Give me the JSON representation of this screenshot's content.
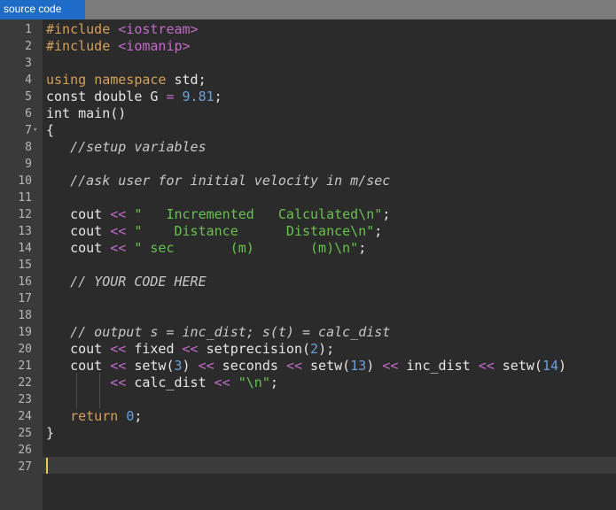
{
  "tab": {
    "label": "source code"
  },
  "colors": {
    "keyword": "#d2a05a",
    "string": "#67c24f",
    "comment": "#c8c8c8",
    "number": "#6ea0d8",
    "operator": "#c06cc8",
    "ident": "#e6e6e6"
  },
  "lines": [
    {
      "n": "1",
      "tokens": [
        [
          "#include",
          "keyword"
        ],
        [
          " ",
          "ident"
        ],
        [
          "<iostream>",
          "operator"
        ]
      ]
    },
    {
      "n": "2",
      "tokens": [
        [
          "#include",
          "keyword"
        ],
        [
          " ",
          "ident"
        ],
        [
          "<iomanip>",
          "operator"
        ]
      ]
    },
    {
      "n": "3",
      "tokens": []
    },
    {
      "n": "4",
      "tokens": [
        [
          "using",
          "keyword"
        ],
        [
          " ",
          "ident"
        ],
        [
          "namespace",
          "keyword"
        ],
        [
          " std;",
          "ident"
        ]
      ]
    },
    {
      "n": "5",
      "tokens": [
        [
          "const double G ",
          "ident"
        ],
        [
          "=",
          "operator"
        ],
        [
          " ",
          "ident"
        ],
        [
          "9.81",
          "number"
        ],
        [
          ";",
          "ident"
        ]
      ]
    },
    {
      "n": "6",
      "tokens": [
        [
          "int main()",
          "ident"
        ]
      ]
    },
    {
      "n": "7",
      "fold": "true",
      "tokens": [
        [
          "{",
          "ident"
        ]
      ]
    },
    {
      "n": "8",
      "tokens": [
        [
          "   //setup variables",
          "comment"
        ]
      ]
    },
    {
      "n": "9",
      "tokens": []
    },
    {
      "n": "10",
      "tokens": [
        [
          "   //ask user for initial velocity in m/sec",
          "comment"
        ]
      ]
    },
    {
      "n": "11",
      "tokens": []
    },
    {
      "n": "12",
      "tokens": [
        [
          "   cout ",
          "ident"
        ],
        [
          "<<",
          "operator"
        ],
        [
          " ",
          "ident"
        ],
        [
          "\"   Incremented   Calculated\\n\"",
          "string"
        ],
        [
          ";",
          "ident"
        ]
      ]
    },
    {
      "n": "13",
      "tokens": [
        [
          "   cout ",
          "ident"
        ],
        [
          "<<",
          "operator"
        ],
        [
          " ",
          "ident"
        ],
        [
          "\"    Distance      Distance\\n\"",
          "string"
        ],
        [
          ";",
          "ident"
        ]
      ]
    },
    {
      "n": "14",
      "tokens": [
        [
          "   cout ",
          "ident"
        ],
        [
          "<<",
          "operator"
        ],
        [
          " ",
          "ident"
        ],
        [
          "\" sec       (m)       (m)\\n\"",
          "string"
        ],
        [
          ";",
          "ident"
        ]
      ]
    },
    {
      "n": "15",
      "tokens": []
    },
    {
      "n": "16",
      "tokens": [
        [
          "   // YOUR CODE HERE",
          "comment"
        ]
      ]
    },
    {
      "n": "17",
      "tokens": []
    },
    {
      "n": "18",
      "tokens": []
    },
    {
      "n": "19",
      "tokens": [
        [
          "   // output s = inc_dist; s(t) = calc_dist",
          "comment"
        ]
      ]
    },
    {
      "n": "20",
      "tokens": [
        [
          "   cout ",
          "ident"
        ],
        [
          "<<",
          "operator"
        ],
        [
          " fixed ",
          "ident"
        ],
        [
          "<<",
          "operator"
        ],
        [
          " setprecision(",
          "ident"
        ],
        [
          "2",
          "number"
        ],
        [
          ");",
          "ident"
        ]
      ]
    },
    {
      "n": "21",
      "tokens": [
        [
          "   cout ",
          "ident"
        ],
        [
          "<<",
          "operator"
        ],
        [
          " setw(",
          "ident"
        ],
        [
          "3",
          "number"
        ],
        [
          ") ",
          "ident"
        ],
        [
          "<<",
          "operator"
        ],
        [
          " seconds ",
          "ident"
        ],
        [
          "<<",
          "operator"
        ],
        [
          " setw(",
          "ident"
        ],
        [
          "13",
          "number"
        ],
        [
          ") ",
          "ident"
        ],
        [
          "<<",
          "operator"
        ],
        [
          " inc_dist ",
          "ident"
        ],
        [
          "<<",
          "operator"
        ],
        [
          " setw(",
          "ident"
        ],
        [
          "14",
          "number"
        ],
        [
          ")",
          "ident"
        ]
      ]
    },
    {
      "n": "22",
      "tokens": [
        [
          "        ",
          "ident"
        ],
        [
          "<<",
          "operator"
        ],
        [
          " calc_dist ",
          "ident"
        ],
        [
          "<<",
          "operator"
        ],
        [
          " ",
          "ident"
        ],
        [
          "\"\\n\"",
          "string"
        ],
        [
          ";",
          "ident"
        ]
      ]
    },
    {
      "n": "23",
      "tokens": []
    },
    {
      "n": "24",
      "tokens": [
        [
          "   ",
          "ident"
        ],
        [
          "return",
          "keyword"
        ],
        [
          " ",
          "ident"
        ],
        [
          "0",
          "number"
        ],
        [
          ";",
          "ident"
        ]
      ]
    },
    {
      "n": "25",
      "tokens": [
        [
          "}",
          "ident"
        ]
      ]
    },
    {
      "n": "26",
      "tokens": []
    },
    {
      "n": "27",
      "tokens": []
    }
  ]
}
